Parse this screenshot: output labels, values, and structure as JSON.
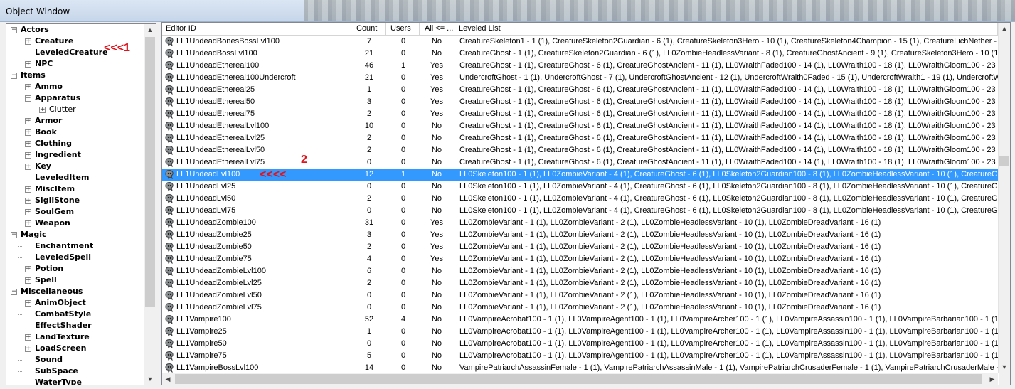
{
  "window": {
    "title": "Object Window"
  },
  "tree": {
    "items": [
      {
        "label": "Actors",
        "level": 0,
        "bold": true,
        "expander": "minus"
      },
      {
        "label": "Creature",
        "level": 1,
        "bold": true,
        "expander": "plus"
      },
      {
        "label": "LeveledCreature",
        "level": 1,
        "bold": true,
        "expander": null
      },
      {
        "label": "NPC",
        "level": 1,
        "bold": true,
        "expander": "plus"
      },
      {
        "label": "Items",
        "level": 0,
        "bold": true,
        "expander": "minus"
      },
      {
        "label": "Ammo",
        "level": 1,
        "bold": true,
        "expander": "plus"
      },
      {
        "label": "Apparatus",
        "level": 1,
        "bold": true,
        "expander": "minus"
      },
      {
        "label": "Clutter",
        "level": 2,
        "bold": false,
        "expander": "plus"
      },
      {
        "label": "Armor",
        "level": 1,
        "bold": true,
        "expander": "plus"
      },
      {
        "label": "Book",
        "level": 1,
        "bold": true,
        "expander": "plus"
      },
      {
        "label": "Clothing",
        "level": 1,
        "bold": true,
        "expander": "plus"
      },
      {
        "label": "Ingredient",
        "level": 1,
        "bold": true,
        "expander": "plus"
      },
      {
        "label": "Key",
        "level": 1,
        "bold": true,
        "expander": "plus"
      },
      {
        "label": "LeveledItem",
        "level": 1,
        "bold": true,
        "expander": null
      },
      {
        "label": "MiscItem",
        "level": 1,
        "bold": true,
        "expander": "plus"
      },
      {
        "label": "SigilStone",
        "level": 1,
        "bold": true,
        "expander": "plus"
      },
      {
        "label": "SoulGem",
        "level": 1,
        "bold": true,
        "expander": "plus"
      },
      {
        "label": "Weapon",
        "level": 1,
        "bold": true,
        "expander": "plus"
      },
      {
        "label": "Magic",
        "level": 0,
        "bold": true,
        "expander": "minus"
      },
      {
        "label": "Enchantment",
        "level": 1,
        "bold": true,
        "expander": null
      },
      {
        "label": "LeveledSpell",
        "level": 1,
        "bold": true,
        "expander": null
      },
      {
        "label": "Potion",
        "level": 1,
        "bold": true,
        "expander": "plus"
      },
      {
        "label": "Spell",
        "level": 1,
        "bold": true,
        "expander": "plus"
      },
      {
        "label": "Miscellaneous",
        "level": 0,
        "bold": true,
        "expander": "minus"
      },
      {
        "label": "AnimObject",
        "level": 1,
        "bold": true,
        "expander": "plus"
      },
      {
        "label": "CombatStyle",
        "level": 1,
        "bold": true,
        "expander": null
      },
      {
        "label": "EffectShader",
        "level": 1,
        "bold": true,
        "expander": null
      },
      {
        "label": "LandTexture",
        "level": 1,
        "bold": true,
        "expander": "plus"
      },
      {
        "label": "LoadScreen",
        "level": 1,
        "bold": true,
        "expander": "plus"
      },
      {
        "label": "Sound",
        "level": 1,
        "bold": true,
        "expander": null
      },
      {
        "label": "SubSpace",
        "level": 1,
        "bold": true,
        "expander": null
      },
      {
        "label": "WaterType",
        "level": 1,
        "bold": true,
        "expander": null
      }
    ]
  },
  "annotations": {
    "a1": "<<<1",
    "a2_num": "2",
    "a2_arrow": "<<<<"
  },
  "table": {
    "columns": [
      "Editor ID",
      "Count",
      "Users",
      "All <= ...",
      "Leveled List"
    ],
    "selected_index": 11,
    "rows": [
      [
        "LL1UndeadBonesBossLvl100",
        "7",
        "0",
        "No",
        "CreatureSkeleton1 - 1 (1), CreatureSkeleton2Guardian - 6 (1), CreatureSkeleton3Hero - 10 (1), CreatureSkeleton4Champion - 15 (1), CreatureLichNether - 17 (1), Cre"
      ],
      [
        "LL1UndeadBossLvl100",
        "21",
        "0",
        "No",
        "CreatureGhost - 1 (1), CreatureSkeleton2Guardian - 6 (1), LL0ZombieHeadlessVariant - 8 (1), CreatureGhostAncient - 9 (1), CreatureSkeleton3Hero - 10 (1), LL0Wr"
      ],
      [
        "LL1UndeadEthereal100",
        "46",
        "1",
        "Yes",
        "CreatureGhost - 1 (1), CreatureGhost - 6 (1), CreatureGhostAncient - 11 (1), LL0WraithFaded100 - 14 (1), LL0Wraith100 - 18 (1), LL0WraithGloom100 - 23 (1)"
      ],
      [
        "LL1UndeadEthereal100Undercroft",
        "21",
        "0",
        "Yes",
        "UndercroftGhost - 1 (1), UndercroftGhost - 7 (1), UndercroftGhostAncient - 12 (1), UndercroftWraith0Faded - 15 (1), UndercroftWraith1 - 19 (1), UndercroftWraith2 -"
      ],
      [
        "LL1UndeadEthereal25",
        "1",
        "0",
        "Yes",
        "CreatureGhost - 1 (1), CreatureGhost - 6 (1), CreatureGhostAncient - 11 (1), LL0WraithFaded100 - 14 (1), LL0Wraith100 - 18 (1), LL0WraithGloom100 - 23 (1)"
      ],
      [
        "LL1UndeadEthereal50",
        "3",
        "0",
        "Yes",
        "CreatureGhost - 1 (1), CreatureGhost - 6 (1), CreatureGhostAncient - 11 (1), LL0WraithFaded100 - 14 (1), LL0Wraith100 - 18 (1), LL0WraithGloom100 - 23 (1)"
      ],
      [
        "LL1UndeadEthereal75",
        "2",
        "0",
        "Yes",
        "CreatureGhost - 1 (1), CreatureGhost - 6 (1), CreatureGhostAncient - 11 (1), LL0WraithFaded100 - 14 (1), LL0Wraith100 - 18 (1), LL0WraithGloom100 - 23 (1)"
      ],
      [
        "LL1UndeadEtherealLvl100",
        "10",
        "0",
        "No",
        "CreatureGhost - 1 (1), CreatureGhost - 6 (1), CreatureGhostAncient - 11 (1), LL0WraithFaded100 - 14 (1), LL0Wraith100 - 18 (1), LL0WraithGloom100 - 23 (1)"
      ],
      [
        "LL1UndeadEtherealLvl25",
        "2",
        "0",
        "No",
        "CreatureGhost - 1 (1), CreatureGhost - 6 (1), CreatureGhostAncient - 11 (1), LL0WraithFaded100 - 14 (1), LL0Wraith100 - 18 (1), LL0WraithGloom100 - 23 (1)"
      ],
      [
        "LL1UndeadEtherealLvl50",
        "2",
        "0",
        "No",
        "CreatureGhost - 1 (1), CreatureGhost - 6 (1), CreatureGhostAncient - 11 (1), LL0WraithFaded100 - 14 (1), LL0Wraith100 - 18 (1), LL0WraithGloom100 - 23 (1)"
      ],
      [
        "LL1UndeadEtherealLvl75",
        "0",
        "0",
        "No",
        "CreatureGhost - 1 (1), CreatureGhost - 6 (1), CreatureGhostAncient - 11 (1), LL0WraithFaded100 - 14 (1), LL0Wraith100 - 18 (1), LL0WraithGloom100 - 23 (1)"
      ],
      [
        "LL1UndeadLvl100",
        "12",
        "1",
        "No",
        "LL0Skeleton100 - 1 (1), LL0ZombieVariant - 4 (1), CreatureGhost - 6 (1), LL0Skeleton2Guardian100 - 8 (1), LL0ZombieHeadlessVariant - 10 (1), CreatureGhostAnc"
      ],
      [
        "LL1UndeadLvl25",
        "0",
        "0",
        "No",
        "LL0Skeleton100 - 1 (1), LL0ZombieVariant - 4 (1), CreatureGhost - 6 (1), LL0Skeleton2Guardian100 - 8 (1), LL0ZombieHeadlessVariant - 10 (1), CreatureGhostAnc"
      ],
      [
        "LL1UndeadLvl50",
        "2",
        "0",
        "No",
        "LL0Skeleton100 - 1 (1), LL0ZombieVariant - 4 (1), CreatureGhost - 6 (1), LL0Skeleton2Guardian100 - 8 (1), LL0ZombieHeadlessVariant - 10 (1), CreatureGhostAnc"
      ],
      [
        "LL1UndeadLvl75",
        "0",
        "0",
        "No",
        "LL0Skeleton100 - 1 (1), LL0ZombieVariant - 4 (1), CreatureGhost - 6 (1), LL0Skeleton2Guardian100 - 8 (1), LL0ZombieHeadlessVariant - 10 (1), CreatureGhostAnc"
      ],
      [
        "LL1UndeadZombie100",
        "31",
        "0",
        "Yes",
        "LL0ZombieVariant - 1 (1), LL0ZombieVariant - 2 (1), LL0ZombieHeadlessVariant - 10 (1), LL0ZombieDreadVariant - 16 (1)"
      ],
      [
        "LL1UndeadZombie25",
        "3",
        "0",
        "Yes",
        "LL0ZombieVariant - 1 (1), LL0ZombieVariant - 2 (1), LL0ZombieHeadlessVariant - 10 (1), LL0ZombieDreadVariant - 16 (1)"
      ],
      [
        "LL1UndeadZombie50",
        "2",
        "0",
        "Yes",
        "LL0ZombieVariant - 1 (1), LL0ZombieVariant - 2 (1), LL0ZombieHeadlessVariant - 10 (1), LL0ZombieDreadVariant - 16 (1)"
      ],
      [
        "LL1UndeadZombie75",
        "4",
        "0",
        "Yes",
        "LL0ZombieVariant - 1 (1), LL0ZombieVariant - 2 (1), LL0ZombieHeadlessVariant - 10 (1), LL0ZombieDreadVariant - 16 (1)"
      ],
      [
        "LL1UndeadZombieLvl100",
        "6",
        "0",
        "No",
        "LL0ZombieVariant - 1 (1), LL0ZombieVariant - 2 (1), LL0ZombieHeadlessVariant - 10 (1), LL0ZombieDreadVariant - 16 (1)"
      ],
      [
        "LL1UndeadZombieLvl25",
        "2",
        "0",
        "No",
        "LL0ZombieVariant - 1 (1), LL0ZombieVariant - 2 (1), LL0ZombieHeadlessVariant - 10 (1), LL0ZombieDreadVariant - 16 (1)"
      ],
      [
        "LL1UndeadZombieLvl50",
        "0",
        "0",
        "No",
        "LL0ZombieVariant - 1 (1), LL0ZombieVariant - 2 (1), LL0ZombieHeadlessVariant - 10 (1), LL0ZombieDreadVariant - 16 (1)"
      ],
      [
        "LL1UndeadZombieLvl75",
        "0",
        "0",
        "No",
        "LL0ZombieVariant - 1 (1), LL0ZombieVariant - 2 (1), LL0ZombieHeadlessVariant - 10 (1), LL0ZombieDreadVariant - 16 (1)"
      ],
      [
        "LL1Vampire100",
        "52",
        "4",
        "No",
        "LL0VampireAcrobat100 - 1 (1), LL0VampireAgent100 - 1 (1), LL0VampireArcher100 - 1 (1), LL0VampireAssassin100 - 1 (1), LL0VampireBarbarian100 - 1 (1), LL0Vampi"
      ],
      [
        "LL1Vampire25",
        "1",
        "0",
        "No",
        "LL0VampireAcrobat100 - 1 (1), LL0VampireAgent100 - 1 (1), LL0VampireArcher100 - 1 (1), LL0VampireAssassin100 - 1 (1), LL0VampireBarbarian100 - 1 (1), LL0Vampi"
      ],
      [
        "LL1Vampire50",
        "0",
        "0",
        "No",
        "LL0VampireAcrobat100 - 1 (1), LL0VampireAgent100 - 1 (1), LL0VampireArcher100 - 1 (1), LL0VampireAssassin100 - 1 (1), LL0VampireBarbarian100 - 1 (1), LL0Vampi"
      ],
      [
        "LL1Vampire75",
        "5",
        "0",
        "No",
        "LL0VampireAcrobat100 - 1 (1), LL0VampireAgent100 - 1 (1), LL0VampireArcher100 - 1 (1), LL0VampireAssassin100 - 1 (1), LL0VampireBarbarian100 - 1 (1), LL0Vampi"
      ],
      [
        "LL1VampireBossLvl100",
        "14",
        "0",
        "No",
        "VampirePatriarchAssassinFemale - 1 (1), VampirePatriarchAssassinMale - 1 (1), VampirePatriarchCrusaderFemale - 1 (1), VampirePatriarchCrusaderMale - 1 (1), Vam"
      ]
    ]
  },
  "colors": {
    "selection": "#3399ff",
    "annotation": "#e0131b"
  },
  "icons": {
    "row": "leveled-creature-icon",
    "expand": "plus-box-icon",
    "collapse": "minus-box-icon"
  }
}
